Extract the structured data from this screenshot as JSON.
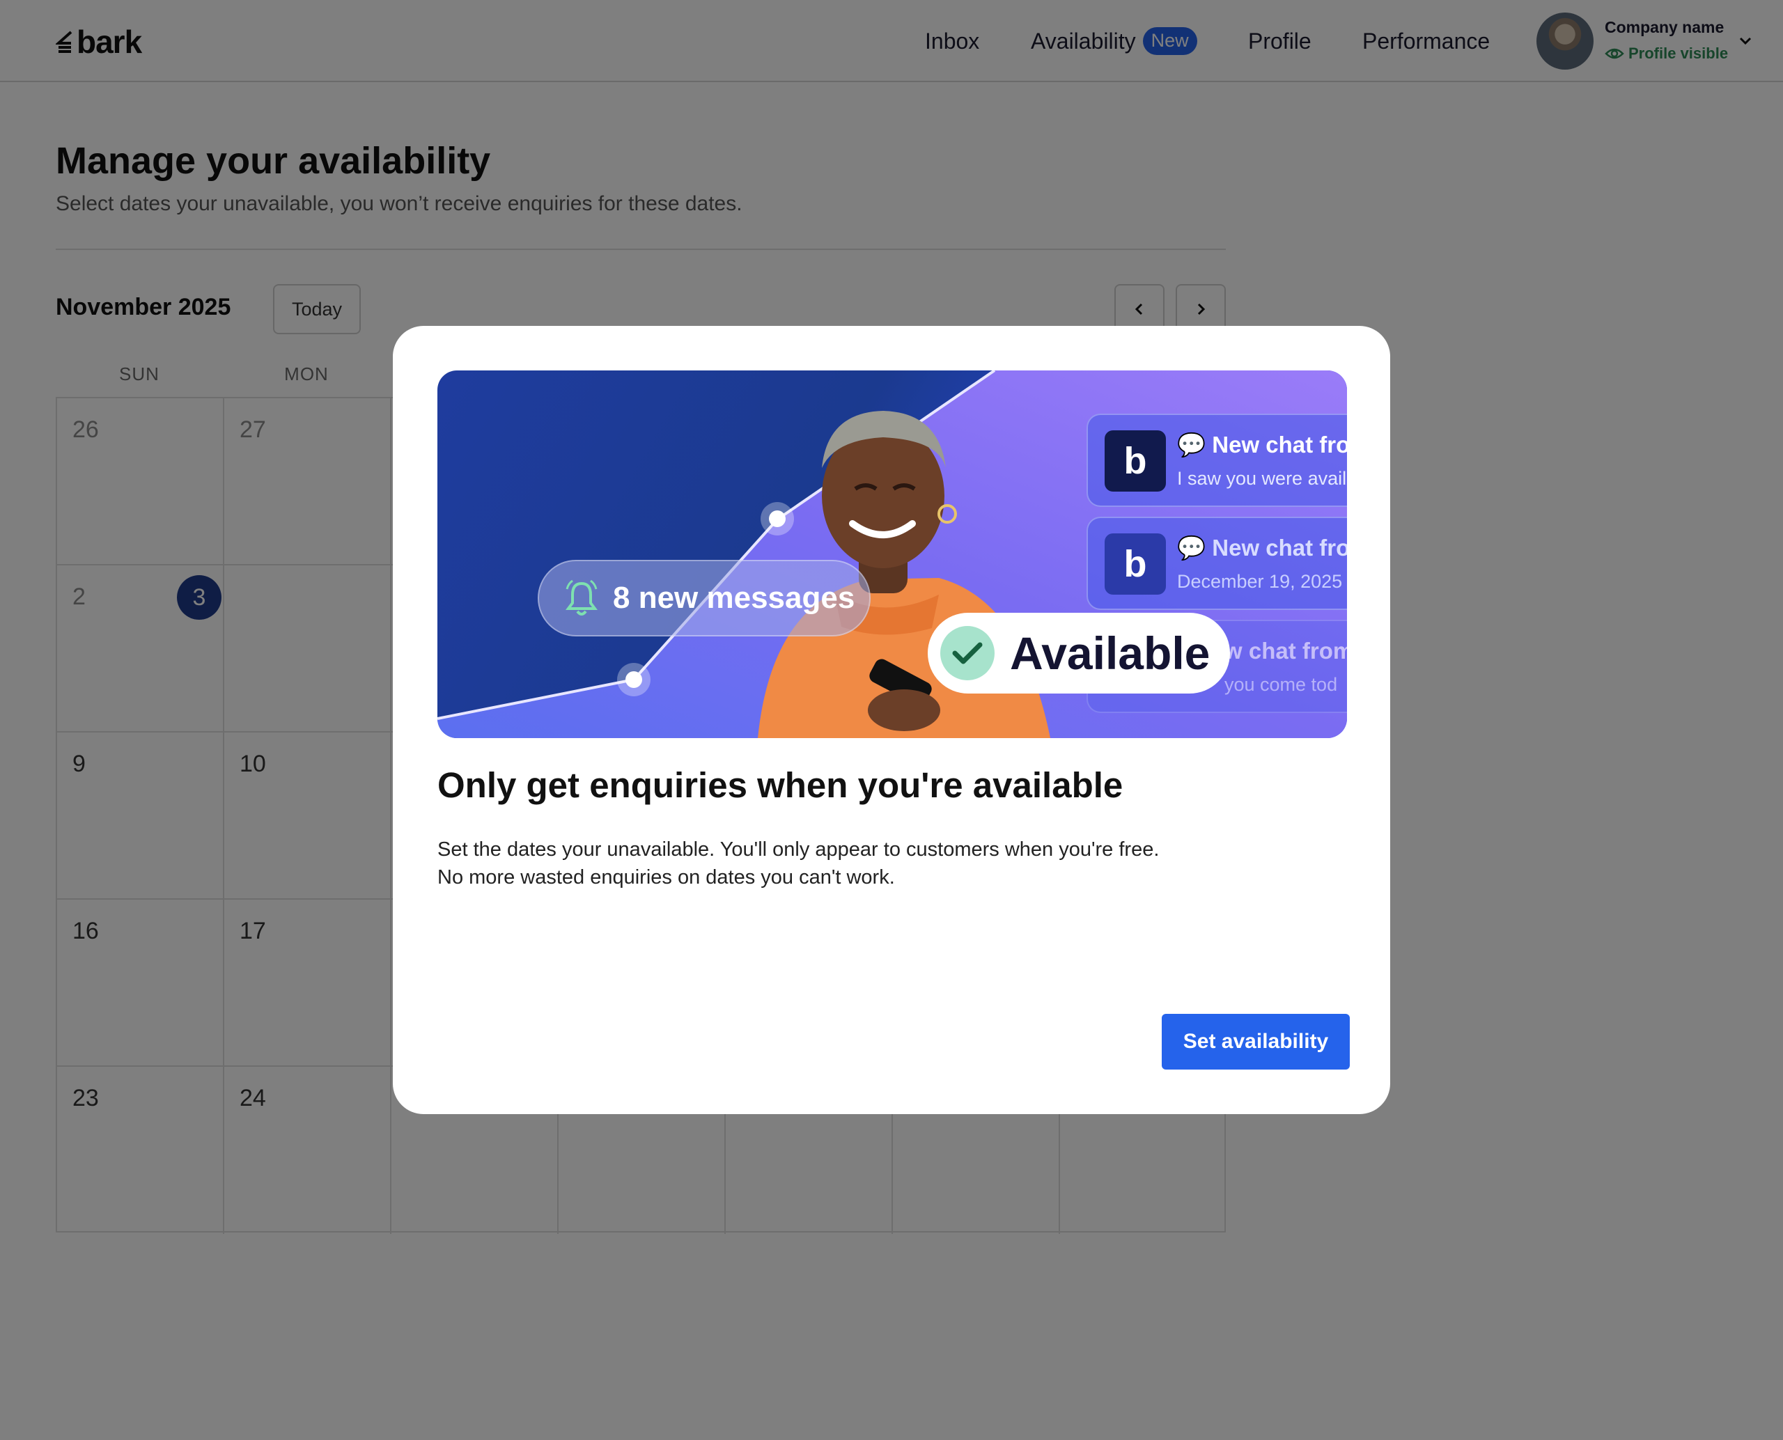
{
  "header": {
    "logo_text": "bark",
    "nav": {
      "inbox": "Inbox",
      "availability": "Availability",
      "availability_badge": "New",
      "profile": "Profile",
      "performance": "Performance"
    },
    "account": {
      "company_name": "Company name",
      "status": "Profile visible",
      "status_color": "#2e8b57"
    }
  },
  "page": {
    "title": "Manage your availability",
    "subtitle": "Select dates your unavailable, you won’t receive enquiries for these dates.",
    "calendar": {
      "month_label": "November 2025",
      "today_button": "Today",
      "weekdays": [
        "SUN",
        "MON"
      ],
      "weeks": [
        [
          "26",
          "27"
        ],
        [
          "2",
          "3"
        ],
        [
          "9",
          "10"
        ],
        [
          "16",
          "17"
        ],
        [
          "23",
          "24"
        ]
      ],
      "selected_day": "3",
      "accent_color": "#1e3a8a"
    }
  },
  "modal": {
    "hero": {
      "messages_pill": "8 new messages",
      "available_pill": "Available",
      "chat_cards": [
        {
          "title": "New chat from",
          "subtitle": "I saw you were avail"
        },
        {
          "title": "New chat from",
          "subtitle": "December 19, 2025"
        },
        {
          "title": "w chat from",
          "subtitle": "you come tod"
        }
      ],
      "logo_letter": "b"
    },
    "title": "Only get enquiries when you're available",
    "body_line1": "Set the dates your unavailable. You'll only appear to customers when you're free.",
    "body_line2": "No more wasted enquiries on dates you can't work.",
    "cta_label": "Set availability",
    "cta_color": "#2563eb"
  }
}
